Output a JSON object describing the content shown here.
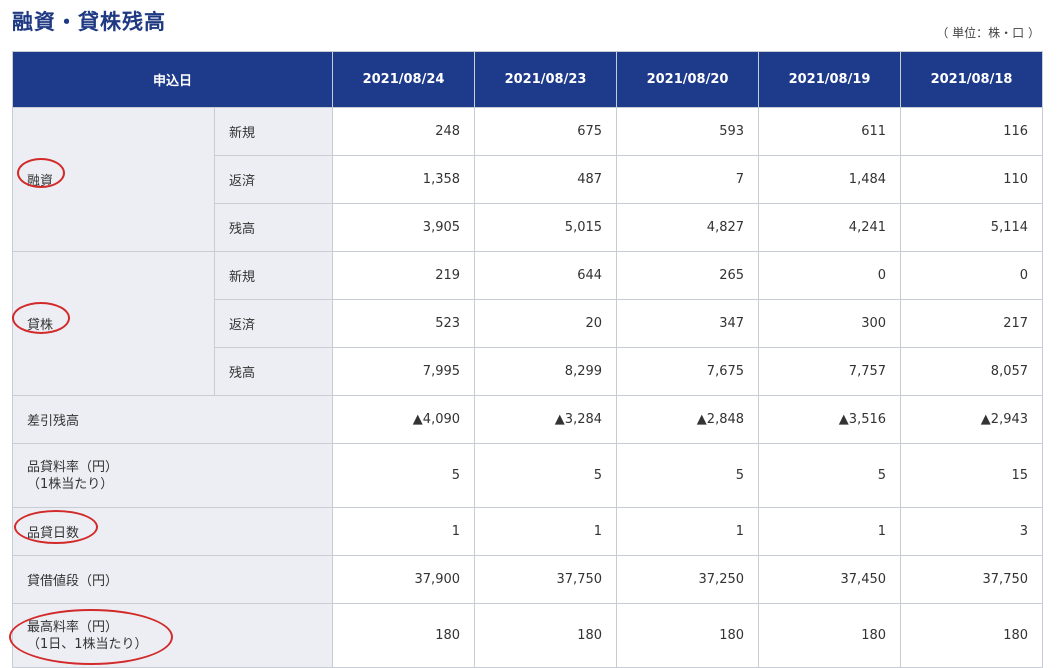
{
  "title": "融資・貸株残高",
  "unit": "（ 単位：株・口 ）",
  "header": {
    "label": "申込日",
    "dates": [
      "2021/08/24",
      "2021/08/23",
      "2021/08/20",
      "2021/08/19",
      "2021/08/18"
    ]
  },
  "groups": {
    "yushi": {
      "label": "融資",
      "rows": [
        {
          "label": "新規",
          "values": [
            "248",
            "675",
            "593",
            "611",
            "116"
          ]
        },
        {
          "label": "返済",
          "values": [
            "1,358",
            "487",
            "7",
            "1,484",
            "110"
          ]
        },
        {
          "label": "残高",
          "values": [
            "3,905",
            "5,015",
            "4,827",
            "4,241",
            "5,114"
          ]
        }
      ]
    },
    "kashikabu": {
      "label": "貸株",
      "rows": [
        {
          "label": "新規",
          "values": [
            "219",
            "644",
            "265",
            "0",
            "0"
          ]
        },
        {
          "label": "返済",
          "values": [
            "523",
            "20",
            "347",
            "300",
            "217"
          ]
        },
        {
          "label": "残高",
          "values": [
            "7,995",
            "8,299",
            "7,675",
            "7,757",
            "8,057"
          ]
        }
      ]
    }
  },
  "rows": {
    "sashihiki": {
      "label": "差引残高",
      "values": [
        "▲4,090",
        "▲3,284",
        "▲2,848",
        "▲3,516",
        "▲2,943"
      ]
    },
    "hingashi_rate": {
      "line1": "品貸料率（円）",
      "line2": "（1株当たり）",
      "values": [
        "5",
        "5",
        "5",
        "5",
        "15"
      ]
    },
    "hingashi_days": {
      "label": "品貸日数",
      "values": [
        "1",
        "1",
        "1",
        "1",
        "3"
      ]
    },
    "taishaku_price": {
      "label": "貸借値段（円）",
      "values": [
        "37,900",
        "37,750",
        "37,250",
        "37,450",
        "37,750"
      ]
    },
    "max_rate": {
      "line1": "最高料率（円）",
      "line2": "（1日、1株当たり）",
      "values": [
        "180",
        "180",
        "180",
        "180",
        "180"
      ]
    }
  }
}
